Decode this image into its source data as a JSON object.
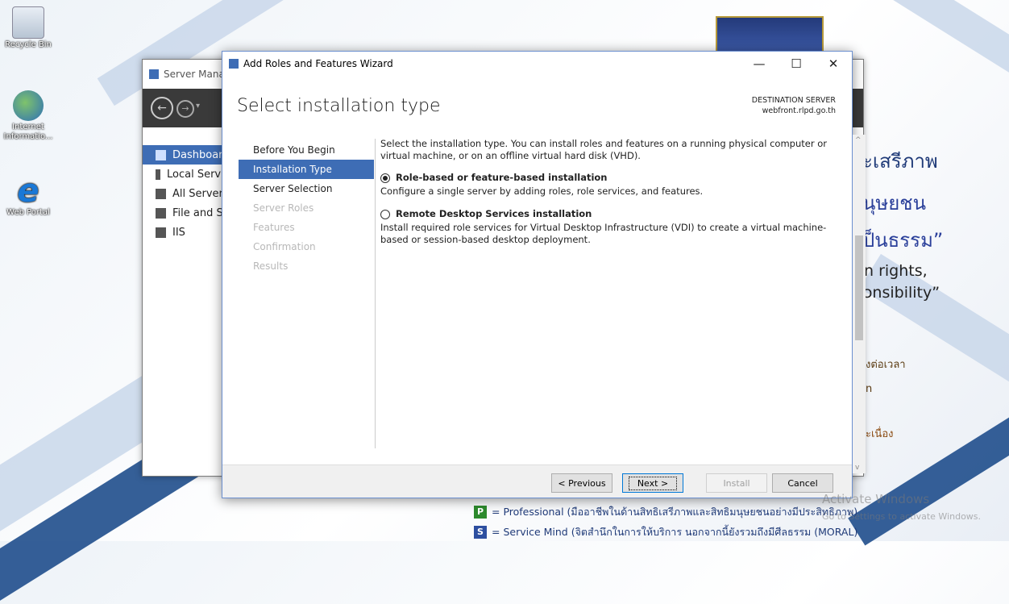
{
  "desktop": {
    "icons": [
      {
        "label": "Recycle Bin",
        "icon": "recycle-bin-icon"
      },
      {
        "label": "Internet Informatio...",
        "icon": "iis-manager-icon"
      },
      {
        "label": "Web Portal",
        "icon": "internet-explorer-icon"
      }
    ],
    "background_texts": {
      "thai1": "ะเสรีภาพ",
      "thai2": "นุษยชน",
      "thai3": "ป็นธรรม”",
      "eng1": "n rights,",
      "eng2": "ɔnsibility”",
      "thai4": "งต่อเวลา",
      "thai5": "n",
      "thai6": "ะเนื่อง",
      "professional": "= Professional (มืออาชีพในด้านสิทธิเสรีภาพและสิทธิมนุษยชนอย่างมีประสิทธิภาพ)",
      "service_mind": "= Service Mind (จิตสำนึกในการให้บริการ นอกจากนี้ยังรวมถึงมีศีลธรรม (MORAL)"
    },
    "activate_windows": {
      "line1": "Activate Windows",
      "line2": "Go to Settings to activate Windows."
    }
  },
  "server_manager": {
    "title": "Server Manag",
    "nav": [
      {
        "label": "Dashboar",
        "icon": "dashboard-icon",
        "active": true
      },
      {
        "label": "Local Serv",
        "icon": "server-icon"
      },
      {
        "label": "All Server",
        "icon": "servers-icon"
      },
      {
        "label": "File and S",
        "icon": "file-storage-icon"
      },
      {
        "label": "IIS",
        "icon": "iis-icon"
      }
    ]
  },
  "wizard": {
    "title": "Add Roles and Features Wizard",
    "heading": "Select installation type",
    "destination_label": "DESTINATION SERVER",
    "destination_server": "webfront.rlpd.go.th",
    "steps": [
      {
        "label": "Before You Begin",
        "state": "done"
      },
      {
        "label": "Installation Type",
        "state": "active"
      },
      {
        "label": "Server Selection",
        "state": "done"
      },
      {
        "label": "Server Roles",
        "state": "disabled"
      },
      {
        "label": "Features",
        "state": "disabled"
      },
      {
        "label": "Confirmation",
        "state": "disabled"
      },
      {
        "label": "Results",
        "state": "disabled"
      }
    ],
    "intro": "Select the installation type. You can install roles and features on a running physical computer or virtual machine, or on an offline virtual hard disk (VHD).",
    "options": [
      {
        "label": "Role-based or feature-based installation",
        "description": "Configure a single server by adding roles, role services, and features.",
        "selected": true
      },
      {
        "label": "Remote Desktop Services installation",
        "description": "Install required role services for Virtual Desktop Infrastructure (VDI) to create a virtual machine-based or session-based desktop deployment.",
        "selected": false
      }
    ],
    "buttons": {
      "previous": "< Previous",
      "next": "Next >",
      "install": "Install",
      "cancel": "Cancel"
    },
    "colors": {
      "accent": "#3e6db5"
    }
  }
}
